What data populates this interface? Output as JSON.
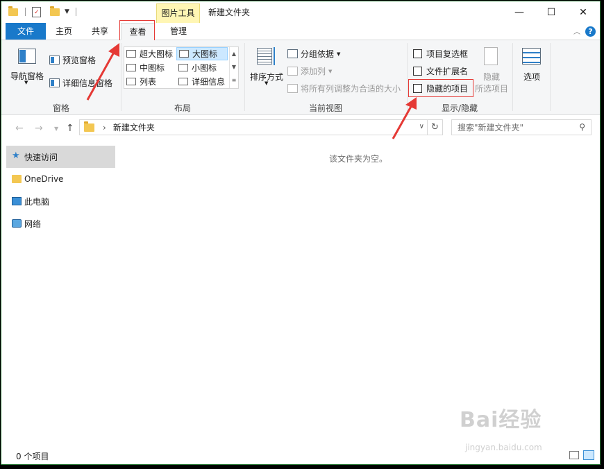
{
  "window": {
    "title": "新建文件夹",
    "context_tab": "图片工具",
    "controls": {
      "minimize": "—",
      "maximize": "☐",
      "close": "✕"
    }
  },
  "tabs": {
    "file": "文件",
    "home": "主页",
    "share": "共享",
    "view": "查看",
    "manage": "管理",
    "help": "?"
  },
  "ribbon": {
    "panes": {
      "nav_pane": "导航窗格",
      "preview_pane": "预览窗格",
      "details_pane": "详细信息窗格",
      "label": "窗格"
    },
    "layout": {
      "items": [
        "超大图标",
        "大图标",
        "中图标",
        "小图标",
        "列表",
        "详细信息"
      ],
      "selected": "大图标",
      "label": "布局"
    },
    "current_view": {
      "sort_by": "排序方式",
      "group_by": "分组依据",
      "add_columns": "添加列",
      "size_all_columns": "将所有列调整为合适的大小",
      "label": "当前视图"
    },
    "show_hide": {
      "item_checkboxes": "项目复选框",
      "file_name_extensions": "文件扩展名",
      "hidden_items": "隐藏的项目",
      "hide_selected_line1": "隐藏",
      "hide_selected_line2": "所选项目",
      "label": "显示/隐藏"
    },
    "options": "选项"
  },
  "address_bar": {
    "path": "新建文件夹",
    "search_placeholder": "搜索\"新建文件夹\""
  },
  "nav_pane": {
    "items": [
      "快速访问",
      "OneDrive",
      "此电脑",
      "网络"
    ],
    "selected": "快速访问"
  },
  "content": {
    "empty_message": "该文件夹为空。"
  },
  "status_bar": {
    "item_count": "0 个项目"
  },
  "colors": {
    "file_tab": "#1979ca",
    "context_tab": "#fff6b4",
    "annotation": "#e53935",
    "selection": "#cce8ff"
  },
  "watermark": {
    "logo": "Bai经验",
    "url": "jingyan.baidu.com"
  }
}
